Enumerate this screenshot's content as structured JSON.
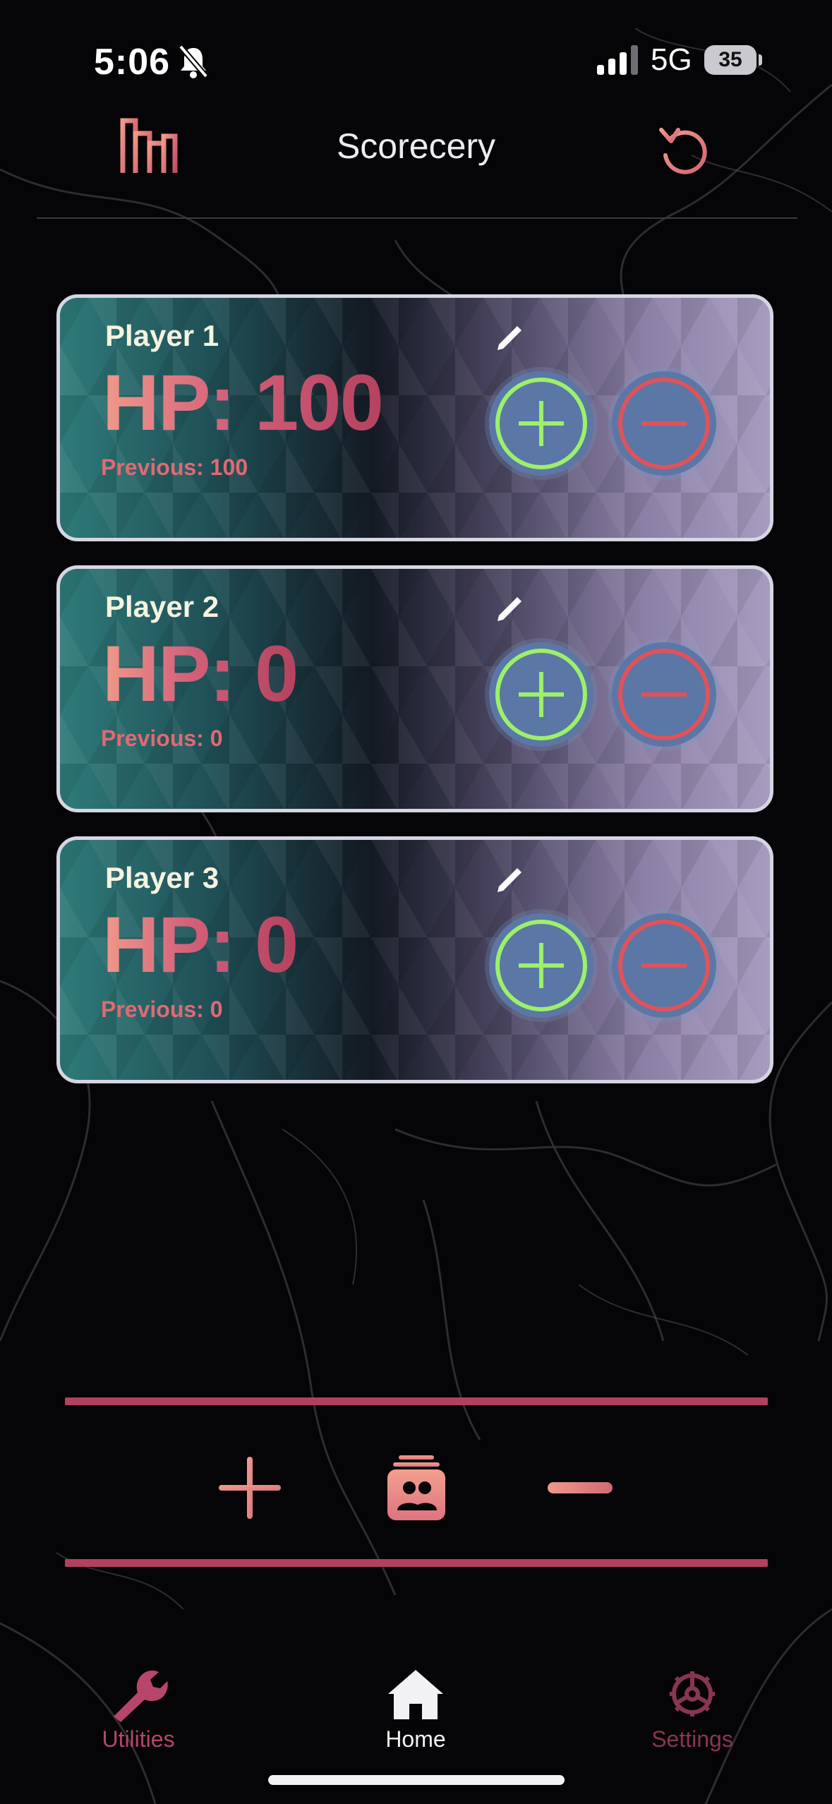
{
  "status_bar": {
    "time": "5:06",
    "network": "5G",
    "battery": "35",
    "icons": [
      "bell-slash-icon",
      "signal-icon",
      "battery-icon"
    ]
  },
  "header": {
    "title": "Scorecery",
    "left_icon": "bar-chart-icon",
    "right_icon": "undo-icon"
  },
  "players": [
    {
      "name": "Player 1",
      "hp": "HP: 100",
      "previous": "Previous: 100"
    },
    {
      "name": "Player 2",
      "hp": "HP: 0",
      "previous": "Previous: 0"
    },
    {
      "name": "Player 3",
      "hp": "HP: 0",
      "previous": "Previous: 0"
    }
  ],
  "controls": {
    "icons": [
      "plus-icon",
      "players-icon",
      "minus-icon"
    ]
  },
  "tab_bar": {
    "items": [
      {
        "label": "Utilities",
        "icon": "wrench-icon",
        "active": false
      },
      {
        "label": "Home",
        "icon": "home-icon",
        "active": true
      },
      {
        "label": "Settings",
        "icon": "gear-icon",
        "active": false
      }
    ]
  },
  "colors": {
    "accent": "#b4405f",
    "salmon": "#f0998a",
    "plus_ring": "#9cf06a",
    "minus_ring": "#e2525a",
    "button_fill": "#5b77a6"
  }
}
